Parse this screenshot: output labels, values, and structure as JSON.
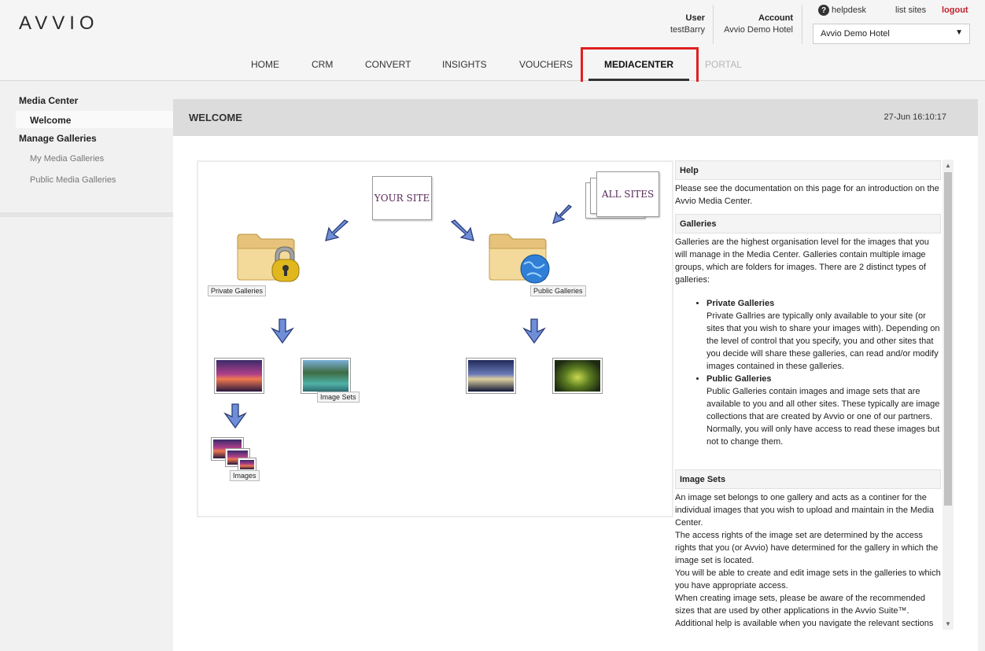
{
  "header": {
    "logo": "AVVIO",
    "user_label": "User",
    "user_value": "testBarry",
    "account_label": "Account",
    "account_value": "Avvio Demo Hotel",
    "helpdesk": "helpdesk",
    "list_sites": "list sites",
    "logout": "logout",
    "site_select": "Avvio Demo Hotel"
  },
  "nav": {
    "items": [
      "HOME",
      "CRM",
      "CONVERT",
      "INSIGHTS",
      "VOUCHERS",
      "MEDIACENTER",
      "PORTAL"
    ],
    "active": "MEDIACENTER"
  },
  "sidebar": {
    "media_center": "Media Center",
    "welcome": "Welcome",
    "manage_galleries": "Manage Galleries",
    "my_media_galleries": "My Media Galleries",
    "public_media_galleries": "Public Media Galleries"
  },
  "main": {
    "title": "WELCOME",
    "timestamp": "27-Jun 16:10:17"
  },
  "diagram": {
    "your_site": "YOUR SITE",
    "all_sites": "ALL SITES",
    "private_galleries": "Private Galleries",
    "public_galleries": "Public Galleries",
    "image_sets": "Image Sets",
    "images": "Images"
  },
  "help": {
    "help_title": "Help",
    "help_text": "Please see the documentation on this page for an introduction on the Avvio Media Center.",
    "galleries_title": "Galleries",
    "galleries_text": "Galleries are the highest organisation level for the images that you will manage in the Media Center. Galleries contain multiple image groups, which are folders for images. There are 2 distinct types of galleries:",
    "private_title": "Private Galleries",
    "private_text": "Private Gallries are typically only available to your site (or sites that you wish to share your images with). Depending on the level of control that you specify, you and other sites that you decide will share these galleries, can read and/or modify images contained in these galleries.",
    "public_title": "Public Galleries",
    "public_text": "Public Galleries contain images and image sets that are available to you and all other sites. These typically are image collections that are created by Avvio or one of our partners. Normally, you will only have access to read these images but not to change them.",
    "image_sets_title": "Image Sets",
    "image_sets_text1": "An image set belongs to one gallery and acts as a continer for the individual images that you wish to upload and maintain in the Media Center.",
    "image_sets_text2": "The access rights of the image set are determined by the access rights that you (or Avvio) have determined for the gallery in which the image set is located.",
    "image_sets_text3": "You will be able to create and edit image sets in the galleries to which you have appropriate access.",
    "image_sets_text4": "When creating image sets, please be aware of the recommended sizes that are used by other applications in the Avvio Suite™.",
    "image_sets_text5": "Additional help is available when you navigate the relevant sections"
  }
}
